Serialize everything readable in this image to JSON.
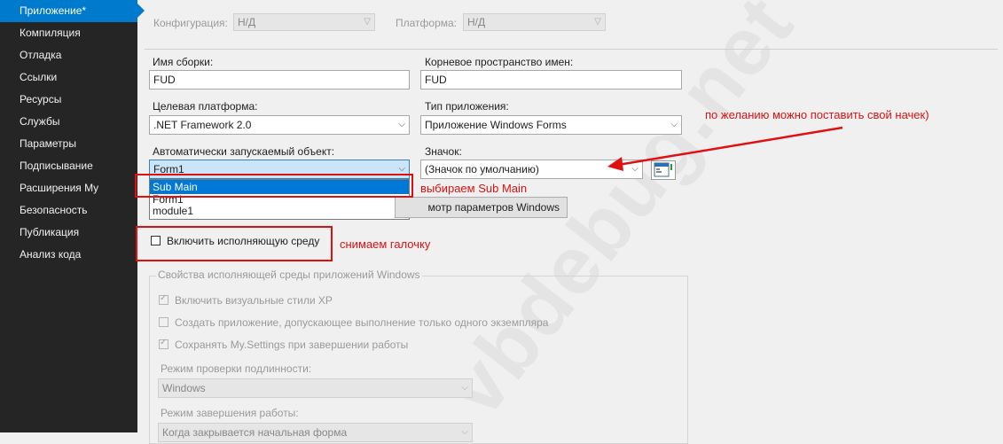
{
  "sidebar": {
    "items": [
      {
        "label": "Приложение*",
        "active": true
      },
      {
        "label": "Компиляция"
      },
      {
        "label": "Отладка"
      },
      {
        "label": "Ссылки"
      },
      {
        "label": "Ресурсы"
      },
      {
        "label": "Службы"
      },
      {
        "label": "Параметры"
      },
      {
        "label": "Подписывание"
      },
      {
        "label": "Расширения My"
      },
      {
        "label": "Безопасность"
      },
      {
        "label": "Публикация"
      },
      {
        "label": "Анализ кода"
      }
    ]
  },
  "toolbar": {
    "config_label": "Конфигурация:",
    "config_value": "Н/Д",
    "platform_label": "Платформа:",
    "platform_value": "Н/Д"
  },
  "form": {
    "assembly_name_label": "Имя сборки:",
    "assembly_name_value": "FUD",
    "root_namespace_label": "Корневое пространство имен:",
    "root_namespace_value": "FUD",
    "target_framework_label": "Целевая платформа:",
    "target_framework_value": ".NET Framework 2.0",
    "app_type_label": "Тип приложения:",
    "app_type_value": "Приложение Windows Forms",
    "startup_object_label": "Автоматически запускаемый объект:",
    "startup_object_value": "Form1",
    "startup_options": [
      "Sub Main",
      "Form1",
      "module1"
    ],
    "icon_label": "Значок:",
    "icon_value": "(Значок по умолчанию)",
    "view_settings_button": "мотр параметров Windows",
    "enable_framework_label": "Включить исполняющую среду"
  },
  "framework_group": {
    "title": "Свойства исполняющей среды приложений Windows",
    "xp_styles_label": "Включить визуальные стили XP",
    "single_instance_label": "Создать приложение, допускающее выполнение только одного экземпляра",
    "save_settings_label": "Сохранять My.Settings при завершении работы",
    "auth_mode_label": "Режим проверки подлинности:",
    "auth_mode_value": "Windows",
    "shutdown_mode_label": "Режим завершения работы:",
    "shutdown_mode_value": "Когда закрывается начальная форма"
  },
  "annotations": {
    "icon_note": "по желанию можно поставить свой начек)",
    "choose_sub_main": "выбираем Sub Main",
    "uncheck_note": "снимаем галочку"
  },
  "watermark": "vbdebug.net",
  "colors": {
    "sidebar_bg": "#252526",
    "active_item": "#007acc",
    "annotation_red": "#e01010",
    "selection_blue": "#0078d7"
  }
}
